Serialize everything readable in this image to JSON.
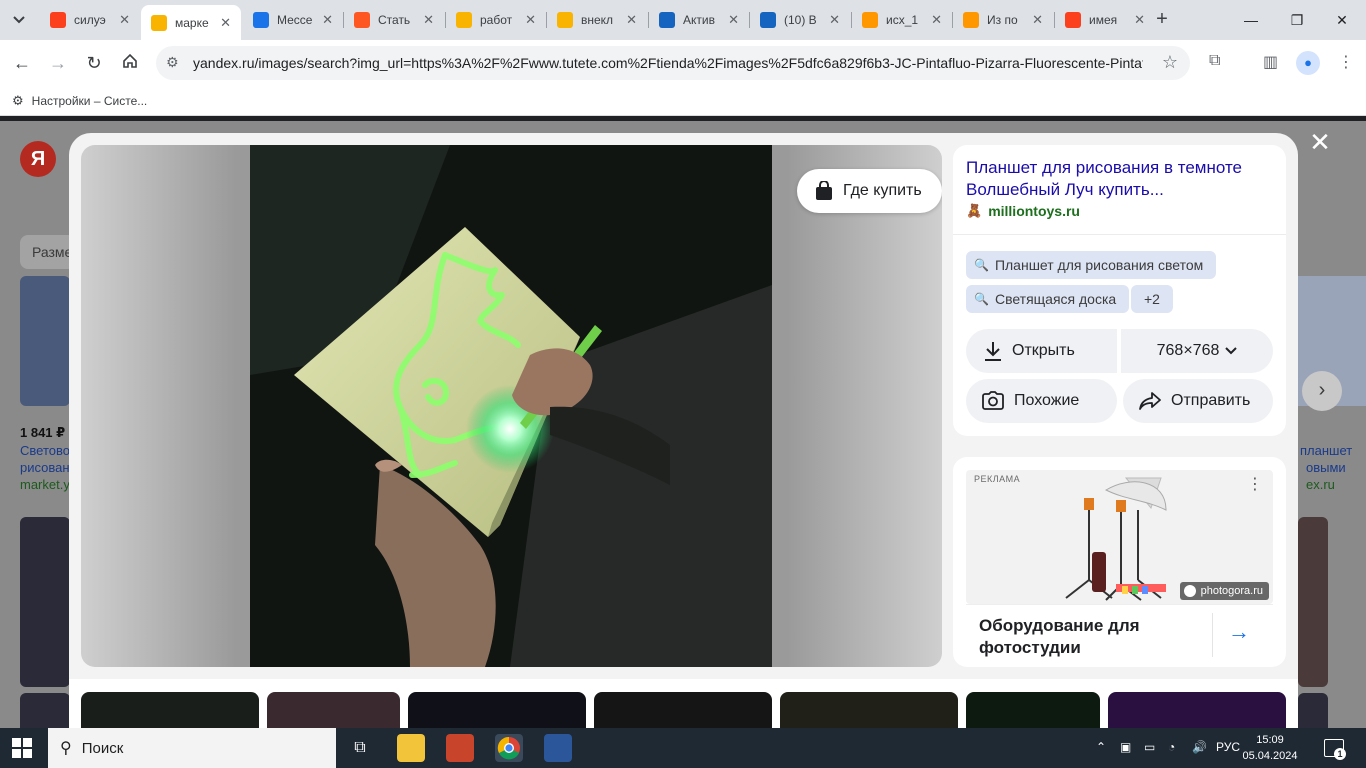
{
  "browser": {
    "tabs": [
      {
        "title": "силуэ",
        "favicon": "yandex-icon",
        "color": "#fc3f1d"
      },
      {
        "title": "марке",
        "favicon": "images-icon",
        "color": "#f8b400",
        "active": true
      },
      {
        "title": "Мессе",
        "favicon": "messenger-icon",
        "color": "#1a73e8"
      },
      {
        "title": "Стать",
        "favicon": "article-icon",
        "color": "#ff5722"
      },
      {
        "title": "работ",
        "favicon": "images-icon",
        "color": "#f8b400"
      },
      {
        "title": "внекл",
        "favicon": "images-icon",
        "color": "#f8b400"
      },
      {
        "title": "Актив",
        "favicon": "book-icon",
        "color": "#1565c0"
      },
      {
        "title": "(10) В",
        "favicon": "mail-icon",
        "color": "#1565c0"
      },
      {
        "title": "исх_1",
        "favicon": "cloud-icon",
        "color": "#ff9800"
      },
      {
        "title": "Из по",
        "favicon": "cloud-icon",
        "color": "#ff9800"
      },
      {
        "title": "имея",
        "favicon": "yandex-icon",
        "color": "#fc3f1d"
      }
    ],
    "url": "yandex.ru/images/search?img_url=https%3A%2F%2Fwww.tutete.com%2Ftienda%2Fimages%2F5dfc6a829f6b3-JC-Pintafluo-Pizarra-Fluorescente-Pintaflu...",
    "bookmark": "Настройки – Систе..."
  },
  "background": {
    "filter_label": "Разме",
    "price": "1 841 ₽",
    "snippet_line1": "Светово",
    "snippet_line2": "рисован",
    "snippet_line3": "market.y",
    "right_line1": "планшет",
    "right_line2": "овыми",
    "right_line3": "ex.ru"
  },
  "viewer": {
    "buy_label": "Где купить",
    "title": "Планшет для рисования в темноте Волшебный Луч купить...",
    "site": "milliontoys.ru",
    "tags": [
      "Планшет для рисования светом",
      "Светящаяся доска"
    ],
    "more_tags": "+2",
    "open_label": "Открыть",
    "size_label": "768×768",
    "similar_label": "Похожие",
    "share_label": "Отправить"
  },
  "ad": {
    "label": "РЕКЛАМА",
    "brand": "photogora.ru",
    "title": "Оборудование для фотостудии"
  },
  "taskbar": {
    "search": "Поиск",
    "lang": "РУС",
    "time": "15:09",
    "date": "05.04.2024",
    "notifications": "1"
  },
  "colors": {
    "link": "#1a0dab",
    "site_green": "#1d6e1d",
    "chip_bg": "#dde4f4",
    "accent": "#1a73e8"
  }
}
